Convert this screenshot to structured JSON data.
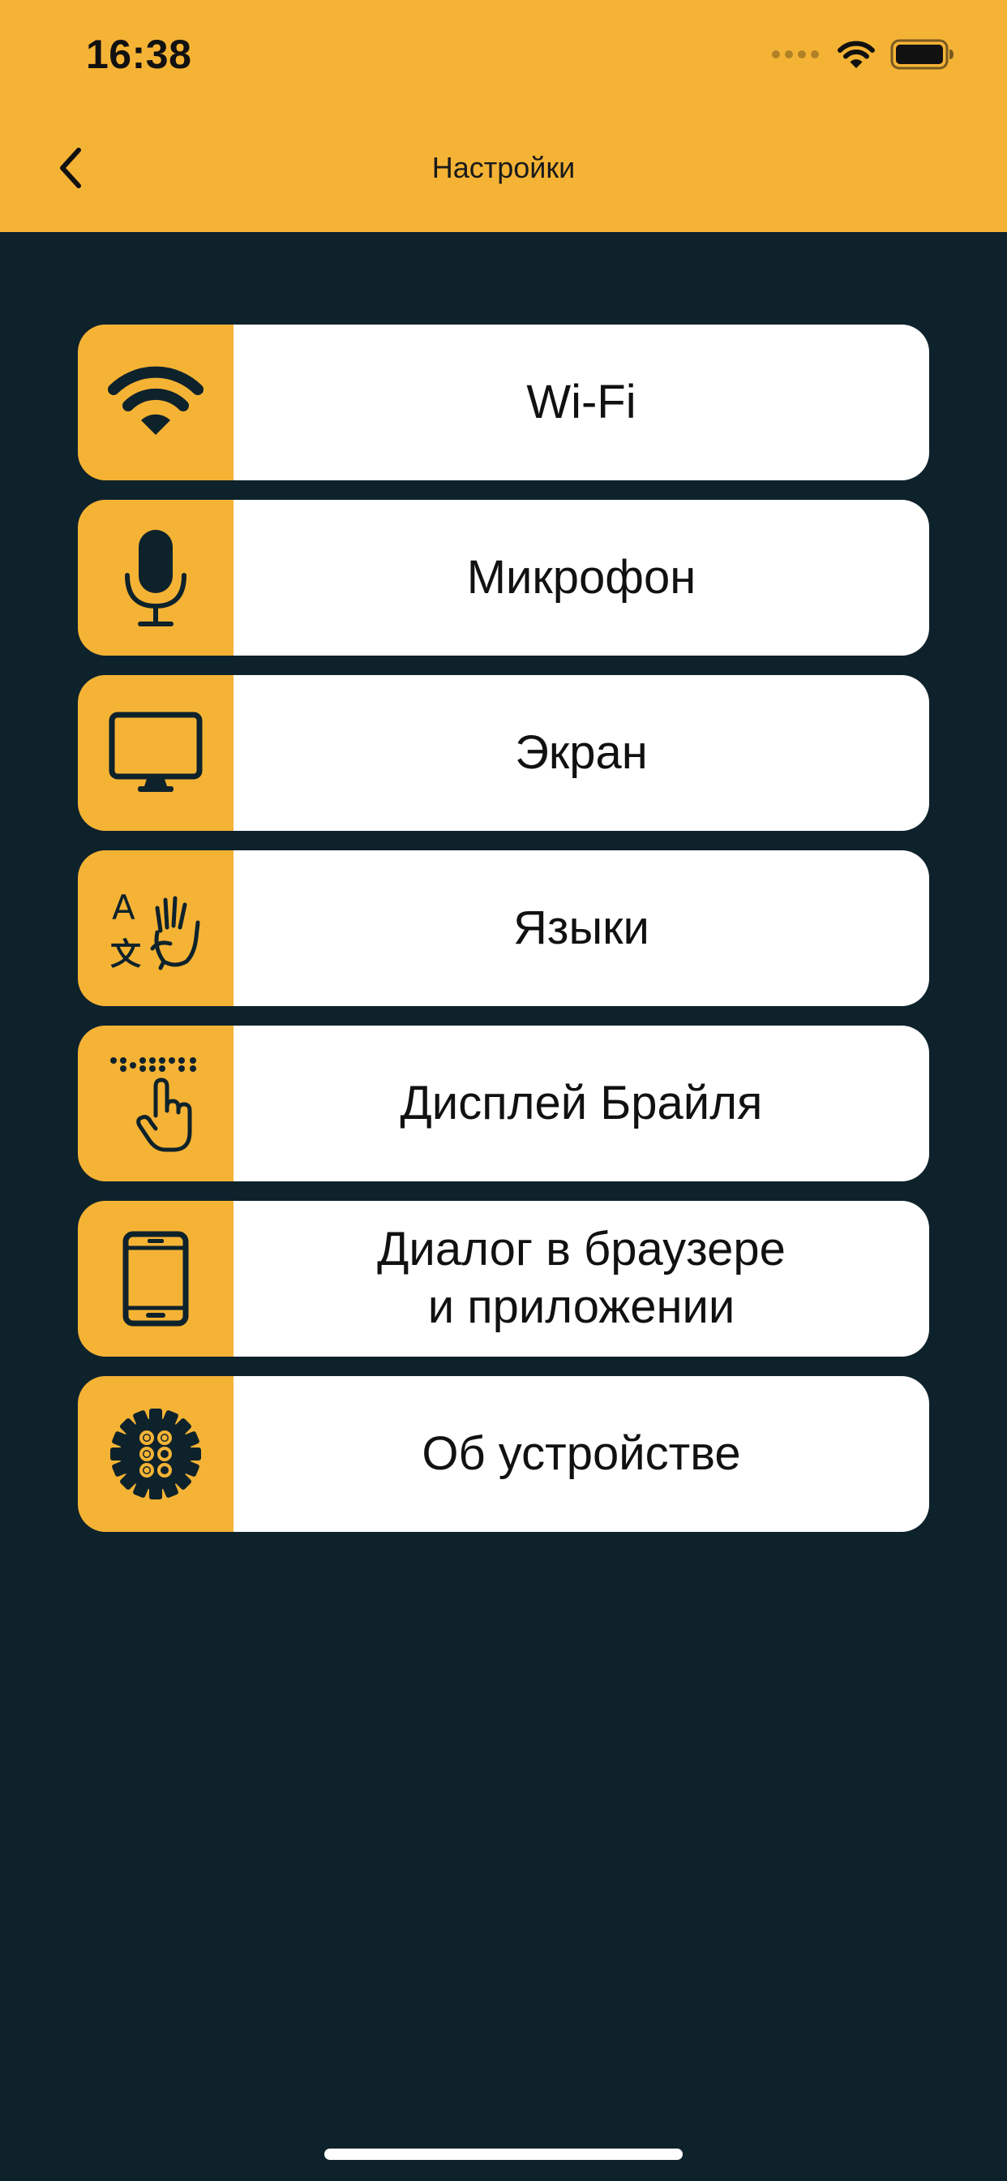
{
  "status_bar": {
    "time": "16:38",
    "icons": [
      "cellular-signal-icon",
      "wifi-icon",
      "battery-icon"
    ]
  },
  "nav": {
    "back_icon": "chevron-left-icon",
    "title": "Настройки"
  },
  "menu": {
    "items": [
      {
        "label": "Wi-Fi",
        "icon": "wifi-icon"
      },
      {
        "label": "Микрофон",
        "icon": "microphone-icon"
      },
      {
        "label": "Экран",
        "icon": "monitor-icon"
      },
      {
        "label": "Языки",
        "icon": "language-sign-icon"
      },
      {
        "label": "Дисплей Брайля",
        "icon": "braille-touch-icon"
      },
      {
        "label": "Диалог в браузере\nи  приложении",
        "icon": "smartphone-icon"
      },
      {
        "label": "Об устройстве",
        "icon": "device-gear-icon"
      }
    ]
  },
  "colors": {
    "accent": "#f5b335",
    "background": "#0e222b",
    "card": "#ffffff",
    "text": "#111111"
  }
}
